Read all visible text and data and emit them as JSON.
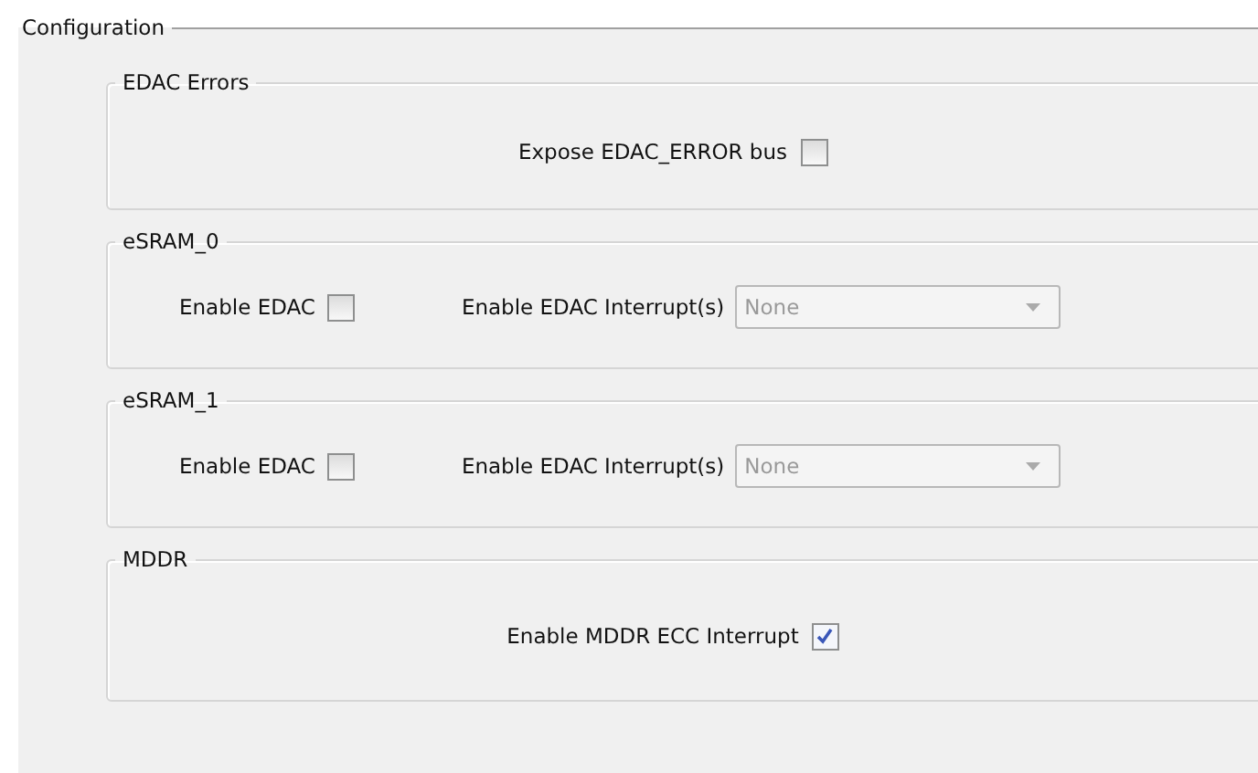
{
  "title": "Configuration",
  "groups": [
    {
      "title": "EDAC Errors",
      "kind": "centered",
      "controls": [
        {
          "kind": "checkbox",
          "label": "Expose EDAC_ERROR bus",
          "checked": false
        }
      ]
    },
    {
      "title": "eSRAM_0",
      "kind": "row",
      "controls": [
        {
          "kind": "checkbox",
          "label": "Enable EDAC",
          "checked": false
        },
        {
          "kind": "select",
          "label": "Enable EDAC Interrupt(s)",
          "value": "None",
          "disabled": true
        }
      ]
    },
    {
      "title": "eSRAM_1",
      "kind": "row",
      "controls": [
        {
          "kind": "checkbox",
          "label": "Enable EDAC",
          "checked": false
        },
        {
          "kind": "select",
          "label": "Enable EDAC Interrupt(s)",
          "value": "None",
          "disabled": true
        }
      ]
    },
    {
      "title": "MDDR",
      "kind": "centered",
      "controls": [
        {
          "kind": "checkbox",
          "label": "Enable MDDR ECC Interrupt",
          "checked": true
        }
      ]
    }
  ]
}
